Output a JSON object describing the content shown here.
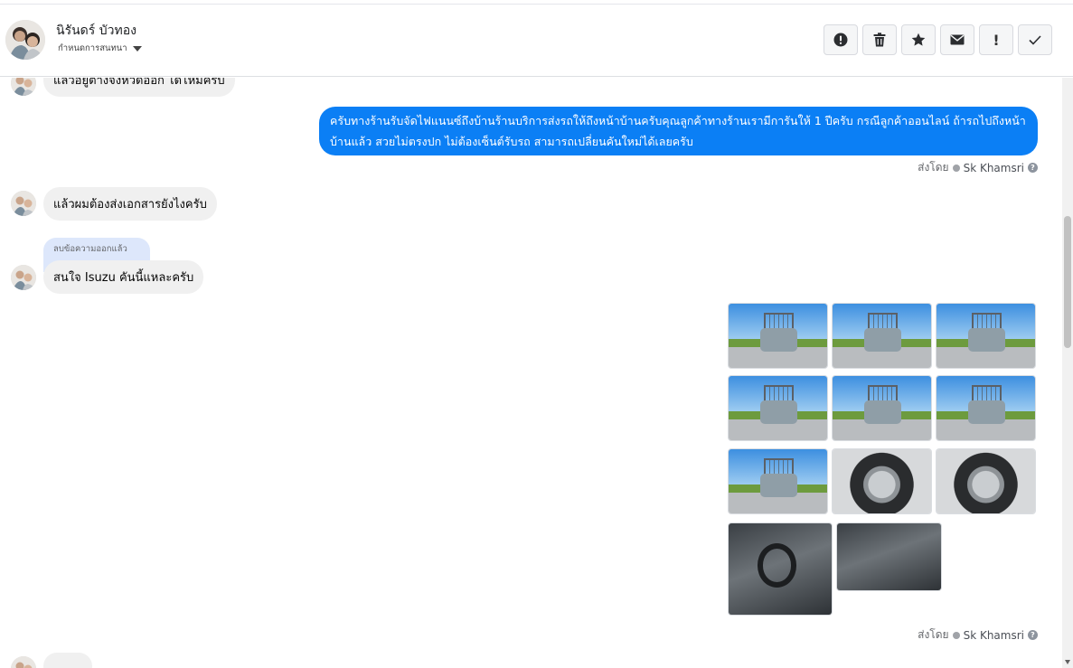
{
  "header": {
    "contact_name": "นิรันดร์ บัวทอง",
    "conversation_status": "กำหนดการสนทนา"
  },
  "messages": {
    "m0_text": "แล้วอยู่ต่างจังหวัดออก ได้ไหมครับ",
    "m1_text": "ครับทางร้านรับจัดไฟแนนซ์ถึงบ้านร้านบริการส่งรถให้ถึงหน้าบ้านครับคุณลูกค้าทางร้านเรามีการันให้ 1 ปีครับ กรณีลูกค้าออนไลน์ ถ้ารถไปถึงหน้าบ้านแล้ว สวยไม่ตรงปก ไม่ต้องเซ็นต์รับรถ สามารถเปลี่ยนคันใหม่ได้เลยครับ",
    "m1_sent_by_label": "ส่งโดย",
    "m1_agent": "Sk Khamsri",
    "m2_text": "แล้วผมต้องส่งเอกสารยังไงครับ",
    "m3_deleted": "ลบข้อความออกแล้ว",
    "m3_text": "สนใจ Isuzu คันนี้แหละครับ",
    "m4_sent_by_label": "ส่งโดย",
    "m4_agent": "Sk Khamsri"
  },
  "icons": {
    "report": "exclamation-circle-icon",
    "delete": "trash-icon",
    "star": "star-icon",
    "mail": "envelope-icon",
    "important": "exclamation-icon",
    "done": "check-icon",
    "help": "?"
  },
  "colors": {
    "outgoing_bubble": "#0b7ff5",
    "incoming_bubble": "#f0f0f0",
    "deleted_tag": "#dde7fb"
  },
  "actions": {
    "important_label": "!"
  }
}
